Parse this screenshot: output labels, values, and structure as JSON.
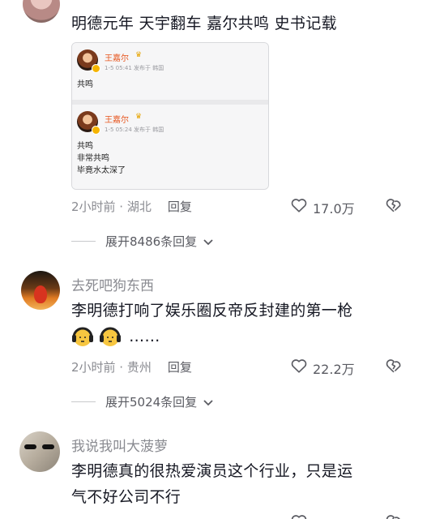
{
  "comment1": {
    "text": "明德元年 天宇翻车 嘉尔共鸣 史书记载",
    "quote": {
      "post1": {
        "name": "王嘉尔",
        "meta": "1-5 05:41 发布于 韩国",
        "text": "共鸣"
      },
      "post2": {
        "name": "王嘉尔",
        "meta": "1-5 05:24 发布于 韩国",
        "lines": [
          "共鸣",
          "非常共鸣",
          "毕竟水太深了"
        ]
      }
    },
    "time": "2小时前 · 湖北",
    "reply": "回复",
    "likes": "17.0万",
    "expand": "展开8486条回复"
  },
  "comment2": {
    "username": "去死吧狗东西",
    "text": "李明德打响了娱乐圈反帝反封建的第一枪",
    "ellipsis": "……",
    "time": "2小时前 · 贵州",
    "reply": "回复",
    "likes": "22.2万",
    "expand": "展开5024条回复"
  },
  "comment3": {
    "username": "我说我叫大菠萝",
    "text_line1": "李明德真的很热爱演员这个行业，只是运",
    "text_line2": "气不好公司不行"
  },
  "colors": {
    "accent_orange": "#e7561f",
    "meta_gray": "#8a8b91",
    "text_dark": "#161823"
  }
}
